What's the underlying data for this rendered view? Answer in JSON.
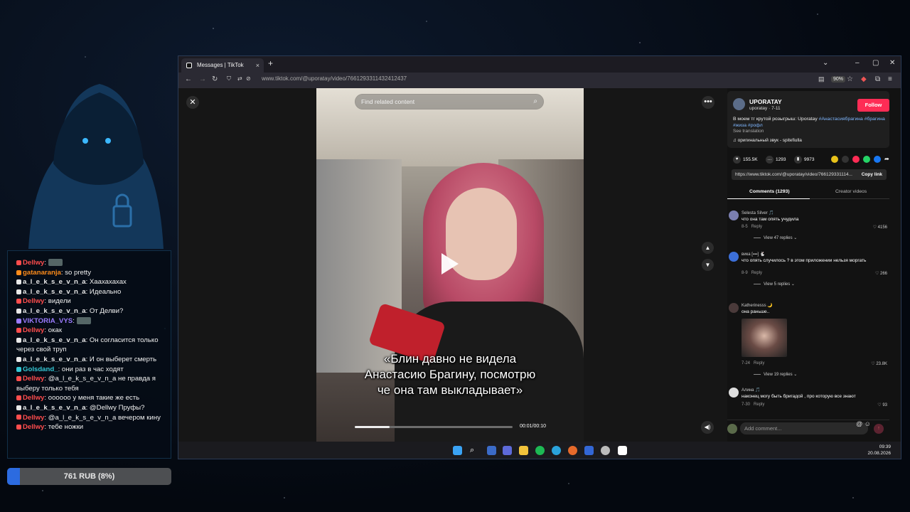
{
  "browser": {
    "tab_title": "Messages | TikTok",
    "tab_close": "×",
    "new_tab": "+",
    "url": "www.tiktok.com/@uporatay/video/7661293311432412437",
    "zoom": "90%"
  },
  "video": {
    "search_placeholder": "Find related content",
    "caption": "«Блин давно не видела Анастасию Брагину, посмотрю че она там выкладывает»",
    "time": "00:01/00:10",
    "progress": 0.22
  },
  "author": {
    "name": "UPORATAY",
    "handle": "uporatay · 7-11",
    "follow_label": "Follow",
    "description": "В моем тг крутой розыгрыш: Uporatay",
    "hashtags": "#Анастасиябрагина #брагина #жиза #рофл",
    "see_translation": "See translation",
    "sound": "♫ оригинальный звук - spitefiulla"
  },
  "stats": {
    "likes": "155.5K",
    "comments": "1293",
    "saves": "9973"
  },
  "link": {
    "url": "https://www.tiktok.com/@uporatay/video/766129331114...",
    "copy_label": "Copy link"
  },
  "tabs": {
    "comments": "Comments (1293)",
    "creator": "Creator videos"
  },
  "comments": [
    {
      "user": "Selesta Silver 🎵",
      "text": "что она там опять учудила",
      "date": "8-5",
      "reply": "Reply",
      "likes": "4156",
      "replies": "View 47 replies ⌄"
    },
    {
      "user": "вика [▪▪▪] 🐇",
      "text": "что опять случилось ? в этом приложении нельзя моргать",
      "date": "8-9",
      "reply": "Reply",
      "likes": "266",
      "replies": "View 5 replies ⌄"
    },
    {
      "user": "Katherinesss 🌙",
      "text": "она раньше..",
      "date": "7-24",
      "reply": "Reply",
      "likes": "23.8K",
      "replies": "View 19 replies ⌄"
    },
    {
      "user": "Алина 🎵",
      "text": "наконец могу быть бригадой , про которую все знают",
      "date": "7-30",
      "reply": "Reply",
      "likes": "93"
    }
  ],
  "add_comment_placeholder": "Add comment...",
  "clock": {
    "time": "09:39",
    "date": "20.08.2026"
  },
  "chat": [
    {
      "user": "Dellwy",
      "color": "#ff4d4d",
      "text": ""
    },
    {
      "user": "gatanaranja",
      "color": "#ff8c1a",
      "text": "so pretty"
    },
    {
      "user": "a_l_e_k_s_e_v_n_a",
      "color": "#e8e8e8",
      "text": "Хаахахахах"
    },
    {
      "user": "a_l_e_k_s_e_v_n_a",
      "color": "#e8e8e8",
      "text": "Идеально"
    },
    {
      "user": "Dellwy",
      "color": "#ff4d4d",
      "text": "видели"
    },
    {
      "user": "a_l_e_k_s_e_v_n_a",
      "color": "#e8e8e8",
      "text": "От Делви?"
    },
    {
      "user": "VIKTORIA_VYS",
      "color": "#9b7bff",
      "text": ""
    },
    {
      "user": "Dellwy",
      "color": "#ff4d4d",
      "text": "окак"
    },
    {
      "user": "a_l_e_k_s_e_v_n_a",
      "color": "#e8e8e8",
      "text": "Он согласится только через свой труп"
    },
    {
      "user": "a_l_e_k_s_e_v_n_a",
      "color": "#e8e8e8",
      "text": "И он выберет смерть"
    },
    {
      "user": "Golsdand_",
      "color": "#35c7d4",
      "text": "они раз в час ходят"
    },
    {
      "user": "Dellwy",
      "color": "#ff4d4d",
      "text": "@a_l_e_k_s_e_v_n_a не правда я выберу только тебя"
    },
    {
      "user": "Dellwy",
      "color": "#ff4d4d",
      "text": "оооооо у меня такие же есть"
    },
    {
      "user": "a_l_e_k_s_e_v_n_a",
      "color": "#e8e8e8",
      "text": "@Dellwy Пруфы?"
    },
    {
      "user": "Dellwy",
      "color": "#ff4d4d",
      "text": "@a_l_e_k_s_e_v_n_a вечером кину"
    },
    {
      "user": "Dellwy",
      "color": "#ff4d4d",
      "text": "тебе ножки"
    }
  ],
  "donation": {
    "label": "761 RUB (8%)",
    "percent": 8
  }
}
